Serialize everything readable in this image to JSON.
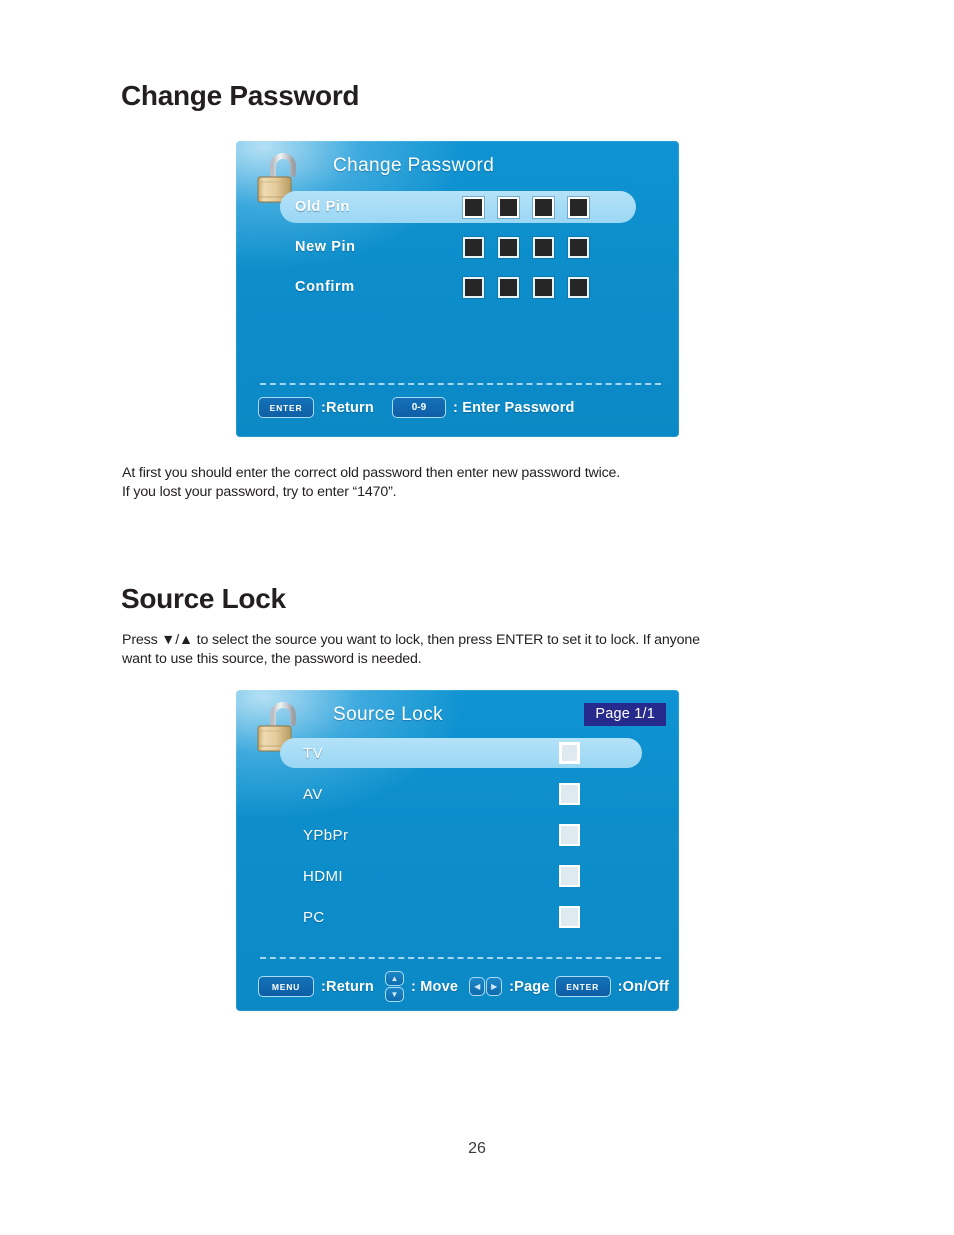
{
  "document": {
    "page_number": "26"
  },
  "sections": [
    {
      "heading": "Change Password",
      "paragraph_line1": "At first you should enter the correct old password  then enter new password twice.",
      "paragraph_line2": "If you lost your password, try to enter   “1470”."
    },
    {
      "heading": "Source Lock",
      "paragraph_line1": "Press  ▼/▲  to select the source you want to lock, then press ENTER to set it to lock. If anyone",
      "paragraph_line2": "want to use this source,  the password is needed."
    }
  ],
  "osd_change_password": {
    "title": "Change Password",
    "lock_icon": "open-padlock-icon",
    "rows": [
      {
        "label": "Old Pin",
        "selected": true,
        "digits": 4
      },
      {
        "label": "New Pin",
        "selected": false,
        "digits": 4
      },
      {
        "label": "Confirm",
        "selected": false,
        "digits": 4
      }
    ],
    "hints": [
      {
        "key": "ENTER",
        "key_type": "label",
        "text": ":Return"
      },
      {
        "key": "0-9",
        "key_type": "numeric",
        "text": ": Enter Password"
      }
    ]
  },
  "osd_source_lock": {
    "title": "Source Lock",
    "lock_icon": "open-padlock-icon",
    "page_badge": "Page 1/1",
    "rows": [
      {
        "label": "TV",
        "selected": true,
        "checked": false
      },
      {
        "label": "AV",
        "selected": false,
        "checked": false
      },
      {
        "label": "YPbPr",
        "selected": false,
        "checked": false
      },
      {
        "label": "HDMI",
        "selected": false,
        "checked": false
      },
      {
        "label": "PC",
        "selected": false,
        "checked": false
      }
    ],
    "hints": [
      {
        "key": "MENU",
        "key_type": "label",
        "text": ":Return"
      },
      {
        "key": "up-down",
        "key_type": "updown",
        "text": ": Move"
      },
      {
        "key": "left-right",
        "key_type": "leftright",
        "text": ":Page"
      },
      {
        "key": "ENTER",
        "key_type": "label",
        "text": ":On/Off"
      }
    ]
  },
  "colors": {
    "panel_blue": "#0d8ecb",
    "highlight_blue": "#a8dcf5",
    "badge_navy": "#262a8c",
    "key_blue": "#0e5fa6",
    "pin_box_dark": "#262626"
  }
}
